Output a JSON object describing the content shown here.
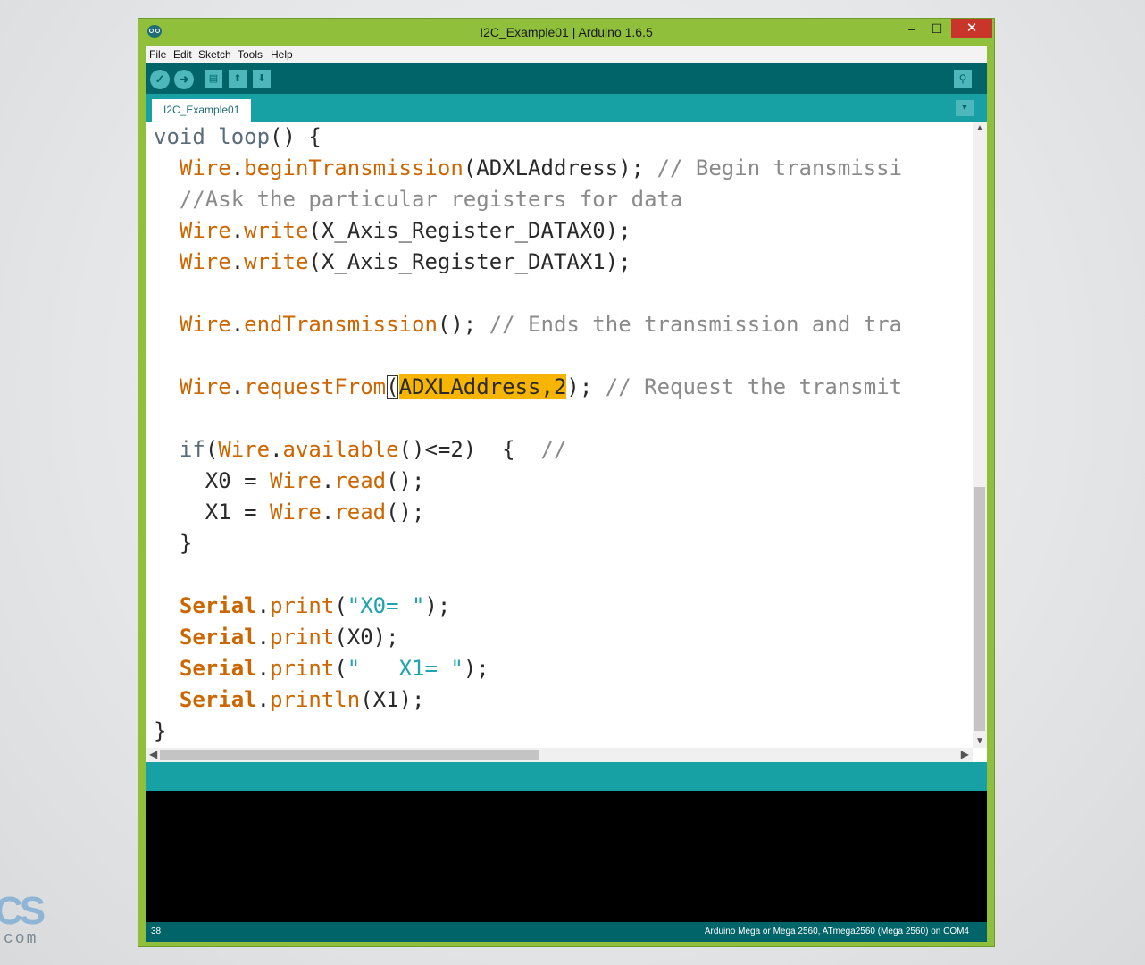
{
  "window": {
    "title": "I2C_Example01 | Arduino 1.6.5",
    "min_glyph": "–",
    "max_glyph": "☐",
    "close_glyph": "✕"
  },
  "menu": [
    "File",
    "Edit",
    "Sketch",
    "Tools",
    "Help"
  ],
  "toolbar": {
    "verify_icon": "check-icon",
    "upload_icon": "arrow-right-icon",
    "new_icon": "new-file-icon",
    "open_icon": "open-arrow-up-icon",
    "save_icon": "save-arrow-down-icon",
    "serial_icon": "magnifier-icon"
  },
  "tab": {
    "label": "I2C_Example01",
    "menu_glyph": "▼"
  },
  "code": {
    "l1_kw": "void",
    "l1_name": "loop",
    "l1_rest": "() {",
    "l2_obj": "Wire",
    "l2_fn": "beginTransmission",
    "l2_args": "(ADXLAddress); ",
    "l2_cm": "// Begin transmissi",
    "l3_cm": "//Ask the particular registers for data",
    "l4_obj": "Wire",
    "l4_fn": "write",
    "l4_args": "(X_Axis_Register_DATAX0);",
    "l5_obj": "Wire",
    "l5_fn": "write",
    "l5_args": "(X_Axis_Register_DATAX1);",
    "l7_obj": "Wire",
    "l7_fn": "endTransmission",
    "l7_args": "(); ",
    "l7_cm": "// Ends the transmission and tra",
    "l9_obj": "Wire",
    "l9_fn": "requestFrom",
    "l9_open": "(",
    "l9_sel": "ADXLAddress,2",
    "l9_close": "); ",
    "l9_cm": "// Request the transmit",
    "l11_kw": "if",
    "l11_open": "(",
    "l11_obj": "Wire",
    "l11_fn": "available",
    "l11_rest": "()<=2)  {  ",
    "l11_cm": "//",
    "l12_var": "X0 = ",
    "l12_obj": "Wire",
    "l12_fn": "read",
    "l12_rest": "();",
    "l13_var": "X1 = ",
    "l13_obj": "Wire",
    "l13_fn": "read",
    "l13_rest": "();",
    "l14": "}",
    "l16_obj": "Serial",
    "l16_fn": "print",
    "l16_open": "(",
    "l16_str": "\"X0= \"",
    "l16_close": ");",
    "l17_obj": "Serial",
    "l17_fn": "print",
    "l17_args": "(X0);",
    "l18_obj": "Serial",
    "l18_fn": "print",
    "l18_open": "(",
    "l18_str": "\"   X1= \"",
    "l18_close": ");",
    "l19_obj": "Serial",
    "l19_fn": "println",
    "l19_args": "(X1);",
    "l20": "}"
  },
  "scroll": {
    "up": "▲",
    "down": "▼",
    "left": "◀",
    "right": "▶"
  },
  "footer": {
    "line_number": "38",
    "board": "Arduino Mega or Mega 2560, ATmega2560 (Mega 2560) on COM4"
  },
  "background": {
    "logo_text": "CS",
    "logo_domain": "com"
  }
}
